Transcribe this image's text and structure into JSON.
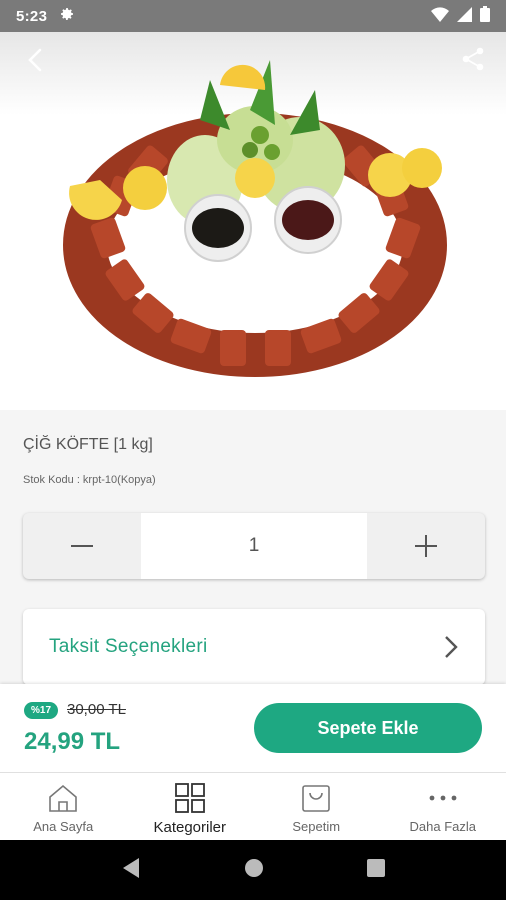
{
  "status_bar": {
    "time": "5:23",
    "icons": [
      "gear-icon",
      "wifi-icon",
      "signal-icon",
      "battery-icon"
    ]
  },
  "header": {
    "icons": [
      "back-arrow-icon",
      "share-icon"
    ]
  },
  "product": {
    "title": "ÇİĞ KÖFTE [1 kg]",
    "stock_code": "Stok Kodu : krpt-10(Kopya)",
    "quantity": "1",
    "installment_label": "Taksit Seçenekleri"
  },
  "price": {
    "discount_badge": "%17",
    "old_price": "30,00 TL",
    "current_price": "24,99 TL",
    "add_to_cart_label": "Sepete Ekle"
  },
  "bottom_nav": {
    "items": [
      {
        "label": "Ana Sayfa",
        "icon": "home-icon"
      },
      {
        "label": "Kategoriler",
        "icon": "grid-icon"
      },
      {
        "label": "Sepetim",
        "icon": "bag-icon"
      },
      {
        "label": "Daha Fazla",
        "icon": "more-icon"
      }
    ]
  },
  "colors": {
    "accent": "#1ea882",
    "accent_text": "#24a37f",
    "status_bar": "#7a7a7a"
  }
}
